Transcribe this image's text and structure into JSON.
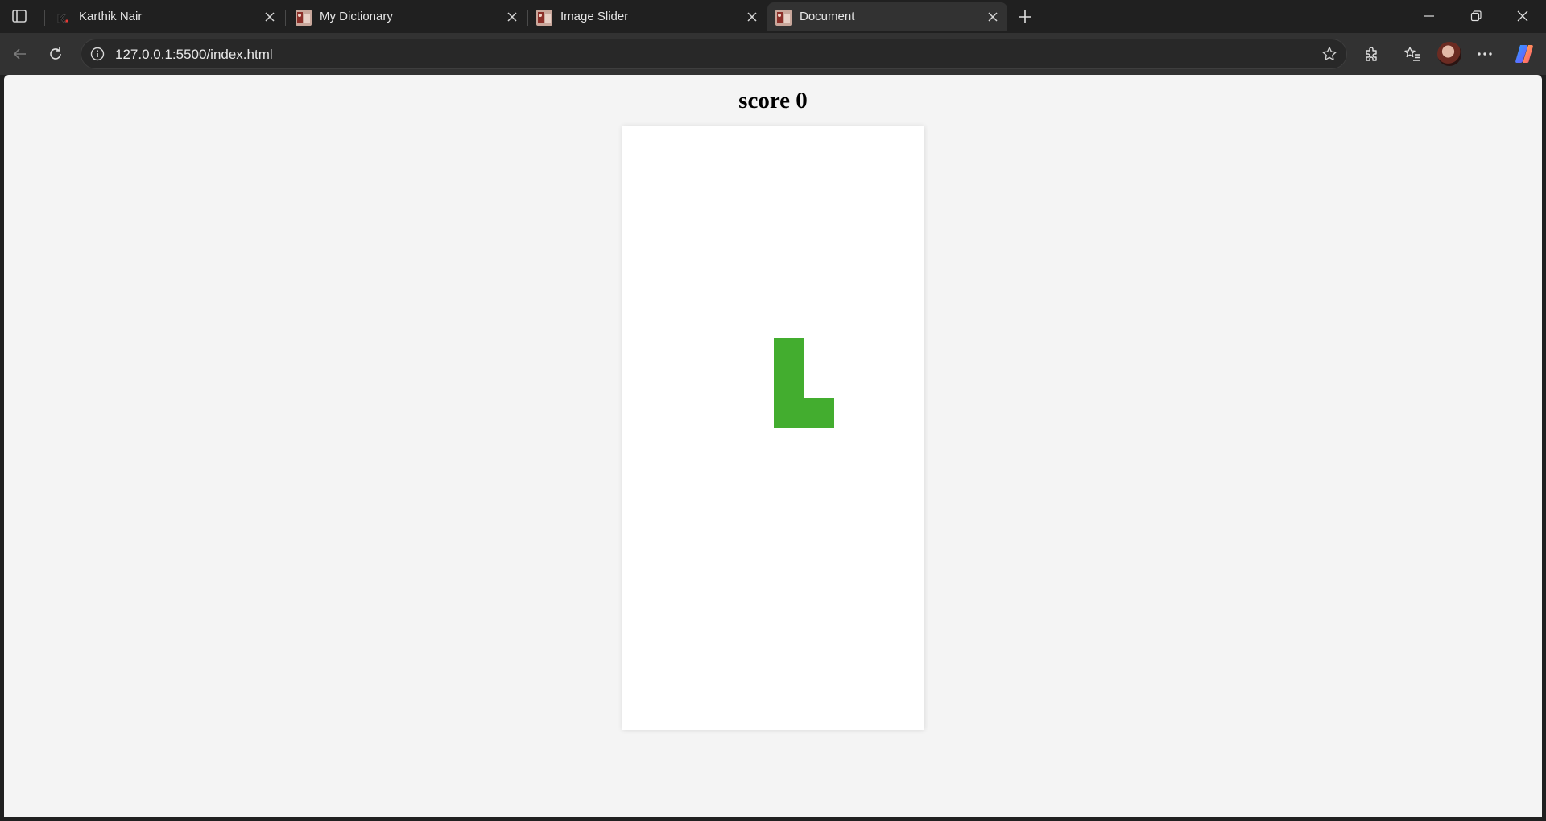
{
  "browser": {
    "tabs": [
      {
        "title": "Karthik Nair",
        "favicon": "k-logo-icon",
        "active": false
      },
      {
        "title": "My Dictionary",
        "favicon": "photo-favicon",
        "active": false
      },
      {
        "title": "Image Slider",
        "favicon": "photo-favicon",
        "active": false
      },
      {
        "title": "Document",
        "favicon": "photo-favicon",
        "active": true
      }
    ],
    "address": "127.0.0.1:5500/index.html"
  },
  "game": {
    "score_text": "score 0",
    "score": 0,
    "board": {
      "columns": 10,
      "rows": 20
    },
    "piece": {
      "type": "L",
      "color": "#43ad2f",
      "cells": [
        [
          5,
          7
        ],
        [
          5,
          8
        ],
        [
          5,
          9
        ],
        [
          6,
          9
        ]
      ]
    }
  },
  "colors": {
    "page_bg": "#f4f4f4",
    "board_bg": "#ffffff",
    "chrome_dark": "#202020",
    "toolbar": "#323232"
  }
}
